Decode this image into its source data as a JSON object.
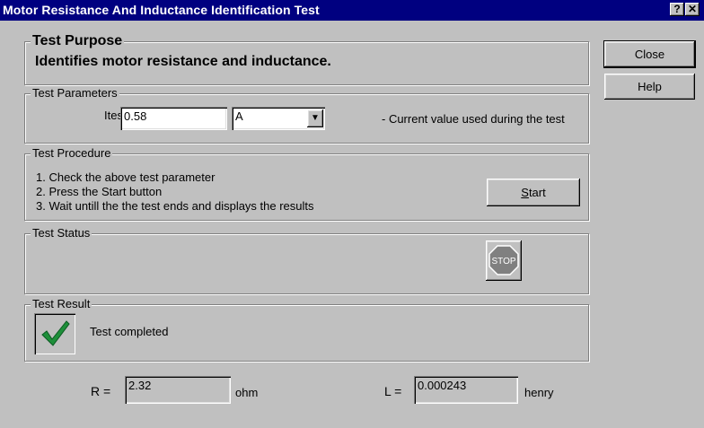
{
  "window": {
    "title": "Motor Resistance And Inductance Identification Test",
    "help_glyph": "?",
    "close_glyph": "✕"
  },
  "buttons": {
    "close": "Close",
    "help": "Help",
    "start_prefix": "S",
    "start_rest": "tart"
  },
  "purpose": {
    "legend": "Test Purpose",
    "text": "Identifies motor resistance and inductance."
  },
  "parameters": {
    "legend": "Test Parameters",
    "itest_label": "Itest",
    "itest_value": "0.58",
    "unit_selected": "A",
    "description": "- Current value used during the test"
  },
  "procedure": {
    "legend": "Test Procedure",
    "steps": [
      "1. Check the above test parameter",
      "2. Press the Start button",
      "3. Wait untill the the test ends and displays the results"
    ]
  },
  "status": {
    "legend": "Test Status",
    "stop_text": "STOP"
  },
  "result": {
    "legend": "Test Result",
    "message": "Test completed",
    "r_label": "R =",
    "r_value": "2.32",
    "r_unit": "ohm",
    "l_label": "L =",
    "l_value": "0.000243",
    "l_unit": "henry"
  },
  "colors": {
    "titlebar": "#000080",
    "face": "#c0c0c0",
    "check": "#1e8f3a",
    "stop": "#808080"
  }
}
